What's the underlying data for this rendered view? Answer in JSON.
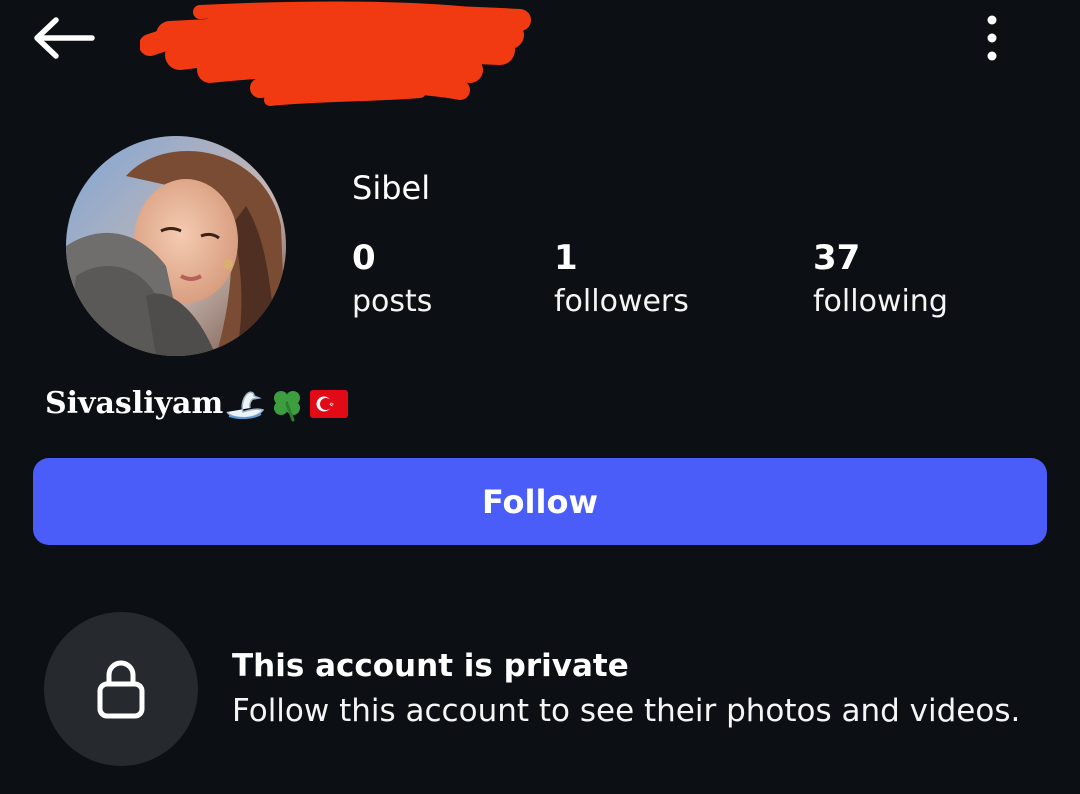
{
  "header": {
    "back_icon": "arrow-left-icon",
    "more_icon": "vertical-ellipsis-icon",
    "username_redaction_color": "#f23a12"
  },
  "profile": {
    "display_name": "Sibel",
    "stats": [
      {
        "value": "0",
        "label": "posts"
      },
      {
        "value": "1",
        "label": "followers"
      },
      {
        "value": "37",
        "label": "following"
      }
    ],
    "bio": {
      "text": "Sivasliyam",
      "emojis": [
        "swan-icon",
        "four-leaf-clover-icon",
        "turkey-flag-icon"
      ]
    }
  },
  "actions": {
    "follow_label": "Follow",
    "follow_color": "#4a5df9"
  },
  "private_notice": {
    "icon": "lock-icon",
    "title": "This account is private",
    "subtitle": "Follow this account to see their photos and videos."
  },
  "colors": {
    "background": "#0c1014",
    "text": "#ffffff",
    "lock_circle": "#26292e"
  }
}
